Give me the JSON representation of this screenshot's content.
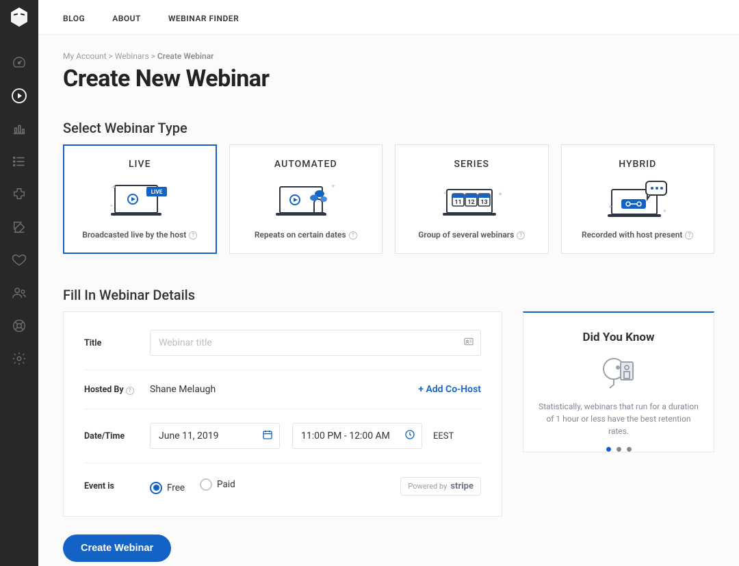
{
  "nav": {
    "blog": "BLOG",
    "about": "ABOUT",
    "finder": "WEBINAR FINDER"
  },
  "breadcrumb": {
    "a": "My Account",
    "b": "Webinars",
    "c": "Create Webinar"
  },
  "page_title": "Create New Webinar",
  "section_type": "Select Webinar Type",
  "types": {
    "live": {
      "title": "LIVE",
      "desc": "Broadcasted live by the host"
    },
    "automated": {
      "title": "AUTOMATED",
      "desc": "Repeats on certain dates"
    },
    "series": {
      "title": "SERIES",
      "desc": "Group of several webinars"
    },
    "hybrid": {
      "title": "HYBRID",
      "desc": "Recorded with host present"
    }
  },
  "section_details": "Fill In Webinar Details",
  "form": {
    "title_label": "Title",
    "title_placeholder": "Webinar title",
    "title_value": "",
    "hosted_label": "Hosted By",
    "host_name": "Shane Melaugh",
    "add_cohost": "+ Add Co-Host",
    "datetime_label": "Date/Time",
    "date_value": "June 11, 2019",
    "time_value": "11:00 PM - 12:00 AM",
    "timezone": "EEST",
    "event_label": "Event is",
    "free_label": "Free",
    "paid_label": "Paid",
    "powered_by": "Powered by",
    "stripe": "stripe"
  },
  "cta": "Create Webinar",
  "dyk": {
    "title": "Did You Know",
    "body": "Statistically, webinars that run for a duration of 1 hour or less have the best retention rates."
  },
  "icons": {
    "logo": "logo",
    "dashboard": "gauge",
    "webinars": "play-circle",
    "analytics": "bar-chart",
    "list": "list",
    "plugin": "puzzle",
    "compose": "edit-square",
    "heart": "heart",
    "users": "users",
    "support": "life-ring",
    "settings": "gear"
  }
}
